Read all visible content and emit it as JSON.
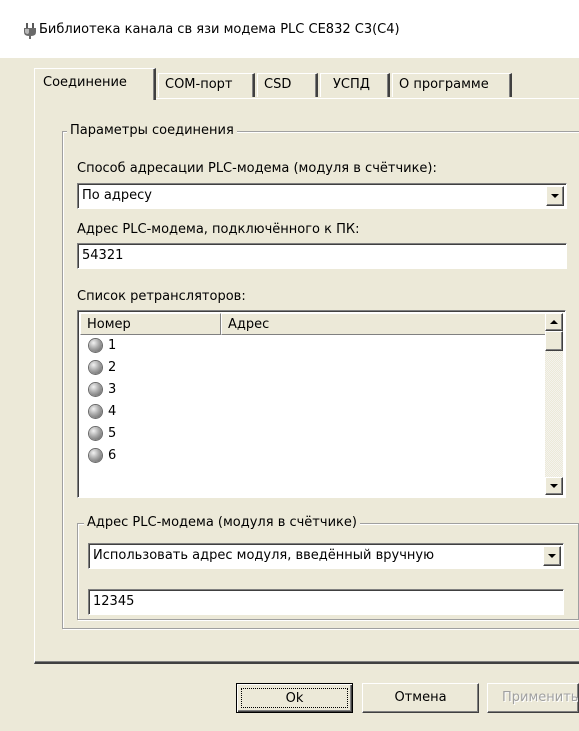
{
  "window": {
    "title": "Библиотека канала св язи модема PLC CE832 C3(C4)",
    "icon": "plug-icon"
  },
  "tabs": [
    {
      "label": "Соединение",
      "active": true
    },
    {
      "label": "COM-порт",
      "active": false
    },
    {
      "label": "CSD",
      "active": false
    },
    {
      "label": "УСПД",
      "active": false
    },
    {
      "label": "О программе",
      "active": false
    }
  ],
  "connection_group": {
    "legend": "Параметры соединения",
    "addressing_label": "Способ адресации PLC-модема (модуля в счётчике):",
    "addressing_value": "По адресу",
    "pc_modem_label": "Адрес PLC-модема, подключённого к ПК:",
    "pc_modem_value": "54321",
    "repeaters_label": "Список ретрансляторов:",
    "repeaters_columns": [
      "Номер",
      "Адрес"
    ],
    "repeaters_rows": [
      {
        "number": "1",
        "address": ""
      },
      {
        "number": "2",
        "address": ""
      },
      {
        "number": "3",
        "address": ""
      },
      {
        "number": "4",
        "address": ""
      },
      {
        "number": "5",
        "address": ""
      },
      {
        "number": "6",
        "address": ""
      }
    ]
  },
  "meter_group": {
    "legend": "Адрес PLC-модема (модуля в счётчике)",
    "mode_value": "Использовать адрес модуля, введённый вручную",
    "address_value": "12345"
  },
  "buttons": {
    "ok": "Ok",
    "cancel": "Отмена",
    "apply": "Применить"
  },
  "colors": {
    "face": "#ece9d8",
    "disabled_text": "#a0a0a0"
  }
}
